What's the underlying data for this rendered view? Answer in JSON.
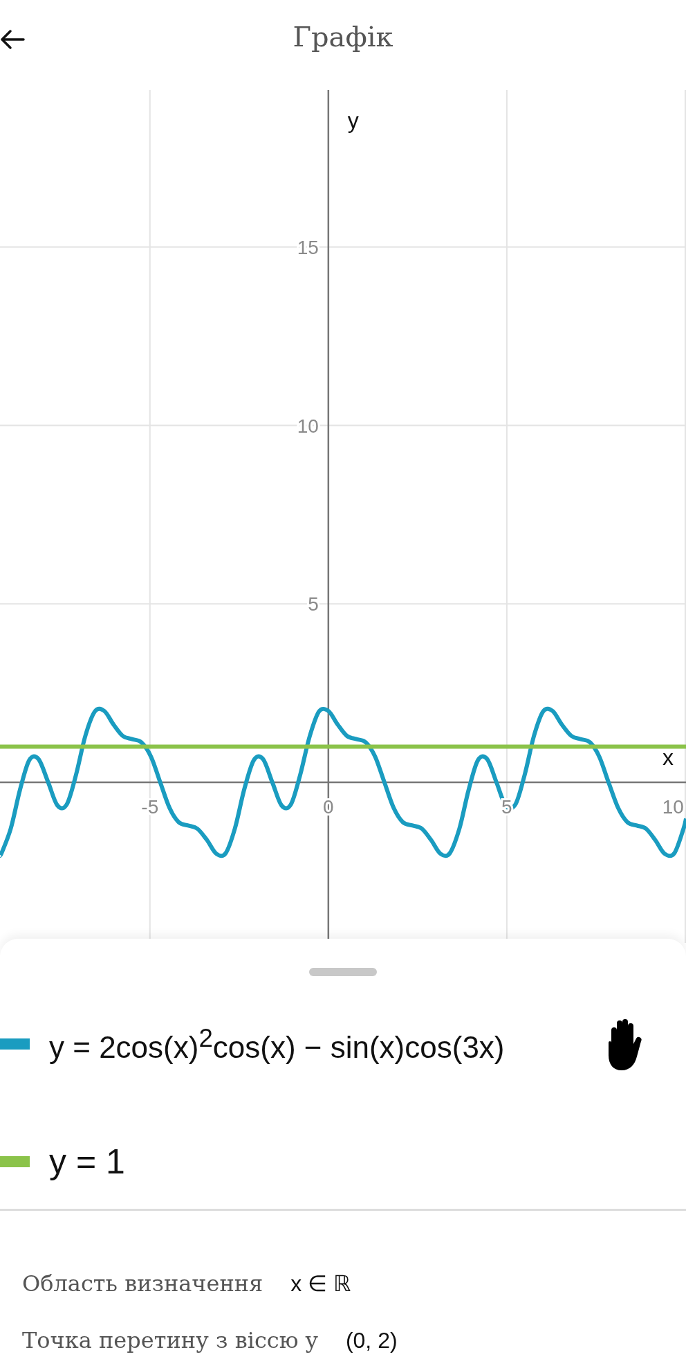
{
  "header": {
    "title": "Графік"
  },
  "graph": {
    "chart_data": {
      "type": "line",
      "grid": true,
      "xlabel": "x",
      "ylabel": "y",
      "xlim": [
        -9.2,
        10.02
      ],
      "ylim": [
        -4.5,
        19.4
      ],
      "xticks": [
        -5,
        0,
        5,
        10
      ],
      "yticks": [
        5,
        10,
        15
      ],
      "x": [
        -9.2,
        -9.16,
        -8.9,
        -8.64,
        -8.38,
        -8.12,
        -7.85,
        -7.59,
        -7.33,
        -7.07,
        -6.81,
        -6.54,
        -6.28,
        -6.02,
        -5.76,
        -5.5,
        -5.24,
        -4.97,
        -4.71,
        -4.45,
        -4.19,
        -3.93,
        -3.67,
        -3.4,
        -3.14,
        -2.88,
        -2.62,
        -2.36,
        -2.09,
        -1.83,
        -1.57,
        -1.31,
        -1.05,
        -0.79,
        -0.52,
        -0.26,
        0,
        0.26,
        0.52,
        0.79,
        1.05,
        1.31,
        1.57,
        1.83,
        2.09,
        2.36,
        2.62,
        2.88,
        3.14,
        3.4,
        3.67,
        3.93,
        4.19,
        4.45,
        4.71,
        4.97,
        5.24,
        5.5,
        5.76,
        6.02,
        6.28,
        6.54,
        6.81,
        7.07,
        7.33,
        7.59,
        7.85,
        8.12,
        8.38,
        8.64,
        8.9,
        9.16,
        9.42,
        9.69,
        9.95,
        10.02
      ],
      "series": [
        {
          "name": "y = 2cos(x)$^{2}$cos(x) − sin(x)cos(3x)",
          "color": "#1a9cc0",
          "values": [
            -2.03,
            -1.99,
            -1.3,
            -0.21,
            0.62,
            0.65,
            0,
            -0.65,
            -0.62,
            0.21,
            1.3,
            1.99,
            2,
            1.62,
            1.3,
            1.21,
            1.12,
            0.72,
            0,
            -0.72,
            -1.12,
            -1.21,
            -1.3,
            -1.62,
            -2,
            -1.99,
            -1.3,
            -0.21,
            0.62,
            0.65,
            0,
            -0.65,
            -0.62,
            0.21,
            1.3,
            1.99,
            2,
            1.62,
            1.3,
            1.21,
            1.12,
            0.72,
            0,
            -0.72,
            -1.12,
            -1.21,
            -1.3,
            -1.62,
            -2,
            -1.99,
            -1.3,
            -0.21,
            0.62,
            0.65,
            0,
            -0.65,
            -0.62,
            0.21,
            1.3,
            1.99,
            2,
            1.62,
            1.3,
            1.21,
            1.12,
            0.72,
            0,
            -0.72,
            -1.12,
            -1.21,
            -1.3,
            -1.62,
            -2,
            -1.99,
            -1.3,
            -1.02
          ]
        },
        {
          "name": "y = 1",
          "color": "#8bc34a",
          "values": [
            1,
            1,
            1,
            1,
            1,
            1,
            1,
            1,
            1,
            1,
            1,
            1,
            1,
            1,
            1,
            1,
            1,
            1,
            1,
            1,
            1,
            1,
            1,
            1,
            1,
            1,
            1,
            1,
            1,
            1,
            1,
            1,
            1,
            1,
            1,
            1,
            1,
            1,
            1,
            1,
            1,
            1,
            1,
            1,
            1,
            1,
            1,
            1,
            1,
            1,
            1,
            1,
            1,
            1,
            1,
            1,
            1,
            1,
            1,
            1,
            1,
            1,
            1,
            1,
            1,
            1,
            1,
            1,
            1,
            1,
            1,
            1,
            1,
            1,
            1,
            1
          ]
        }
      ]
    }
  },
  "legend": [
    {
      "hand": true
    },
    {
      "hand": false
    }
  ],
  "properties": [
    {
      "label": "Область визначення",
      "value": "x ∈ ℝ"
    },
    {
      "label": "Точка перетину з віссю y",
      "value": "(0, 2)"
    }
  ]
}
